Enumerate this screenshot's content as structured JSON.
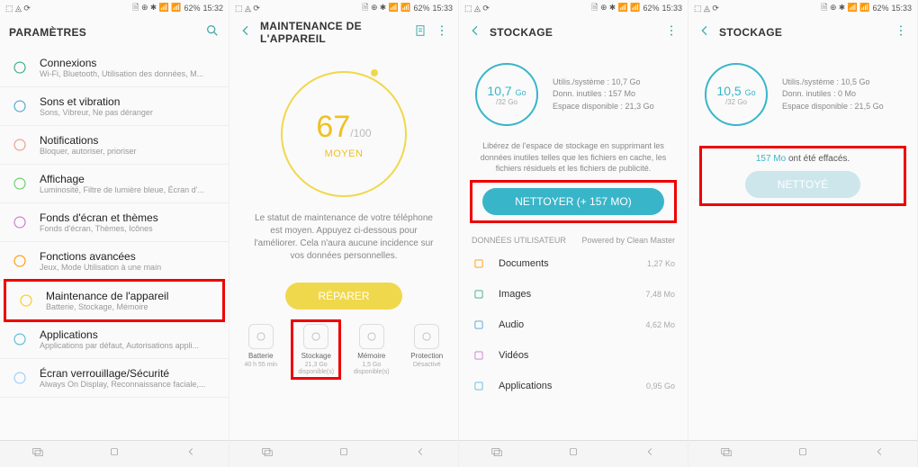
{
  "status": {
    "battery": "62%",
    "time1": "15:32",
    "time2": "15:33",
    "icons_left": "⬚ ◬ ⟳",
    "icons_right": "🗎 ⊕ ✱ 📶 📶"
  },
  "colors": {
    "accent": "#39b5c9",
    "warn": "#f0c020",
    "highlight": "#e00"
  },
  "s1": {
    "title": "PARAMÈTRES",
    "items": [
      {
        "title": "Connexions",
        "sub": "Wi-Fi, Bluetooth, Utilisation des données, M...",
        "color": "#3a8"
      },
      {
        "title": "Sons et vibration",
        "sub": "Sons, Vibreur, Ne pas déranger",
        "color": "#4aa7d0"
      },
      {
        "title": "Notifications",
        "sub": "Bloquer, autoriser, prioriser",
        "color": "#e98"
      },
      {
        "title": "Affichage",
        "sub": "Luminosité, Filtre de lumière bleue, Écran d'...",
        "color": "#6c6"
      },
      {
        "title": "Fonds d'écran et thèmes",
        "sub": "Fonds d'écran, Thèmes, Icônes",
        "color": "#c7c"
      },
      {
        "title": "Fonctions avancées",
        "sub": "Jeux, Mode Utilisation à une main",
        "color": "#f90"
      },
      {
        "title": "Maintenance de l'appareil",
        "sub": "Batterie, Stockage, Mémoire",
        "color": "#fc0",
        "highlight": true
      },
      {
        "title": "Applications",
        "sub": "Applications par défaut, Autorisations appli...",
        "color": "#5bd"
      },
      {
        "title": "Écran verrouillage/Sécurité",
        "sub": "Always On Display, Reconnaissance faciale,...",
        "color": "#9cf"
      }
    ]
  },
  "s2": {
    "title": "MAINTENANCE DE L'APPAREIL",
    "score": "67",
    "scoreMax": "/100",
    "status": "MOYEN",
    "desc": "Le statut de maintenance de votre téléphone est moyen. Appuyez ci-dessous pour l'améliorer. Cela n'aura aucune incidence sur vos données personnelles.",
    "btn": "RÉPARER",
    "tabs": [
      {
        "label": "Batterie",
        "sub": "40 h 55 min"
      },
      {
        "label": "Stockage",
        "sub": "21,3 Go disponible(s)",
        "highlight": true
      },
      {
        "label": "Mémoire",
        "sub": "1,5 Go disponible(s)"
      },
      {
        "label": "Protection",
        "sub": "Désactivé"
      }
    ]
  },
  "s3": {
    "title": "STOCKAGE",
    "used": "10,7",
    "unit": "Go",
    "total": "/32 Go",
    "info1": "Utilis./système : 10,7 Go",
    "info2": "Donn. inutiles : 157 Mo",
    "info3": "Espace disponible : 21,3 Go",
    "desc": "Libérez de l'espace de stockage en supprimant les données inutiles telles que les fichiers en cache, les fichiers résiduels et les fichiers de publicité.",
    "btn": "NETTOYER (+ 157 MO)",
    "sectionHead": "DONNÉES UTILISATEUR",
    "powered": "Powered by Clean Master",
    "items": [
      {
        "name": "Documents",
        "size": "1,27 Ko",
        "color": "#f90"
      },
      {
        "name": "Images",
        "size": "7,48 Mo",
        "color": "#3a8"
      },
      {
        "name": "Audio",
        "size": "4,62 Mo",
        "color": "#4aa7d0"
      },
      {
        "name": "Vidéos",
        "size": "",
        "color": "#c7c"
      },
      {
        "name": "Applications",
        "size": "0,95 Go",
        "color": "#5bd"
      }
    ]
  },
  "s4": {
    "title": "STOCKAGE",
    "used": "10,5",
    "unit": "Go",
    "total": "/32 Go",
    "info1": "Utilis./système : 10,5 Go",
    "info2": "Donn. inutiles : 0 Mo",
    "info3": "Espace disponible : 21,5 Go",
    "cleanedVal": "157 Mo",
    "cleanedTxt": " ont été effacés.",
    "btn": "NETTOYÉ"
  }
}
